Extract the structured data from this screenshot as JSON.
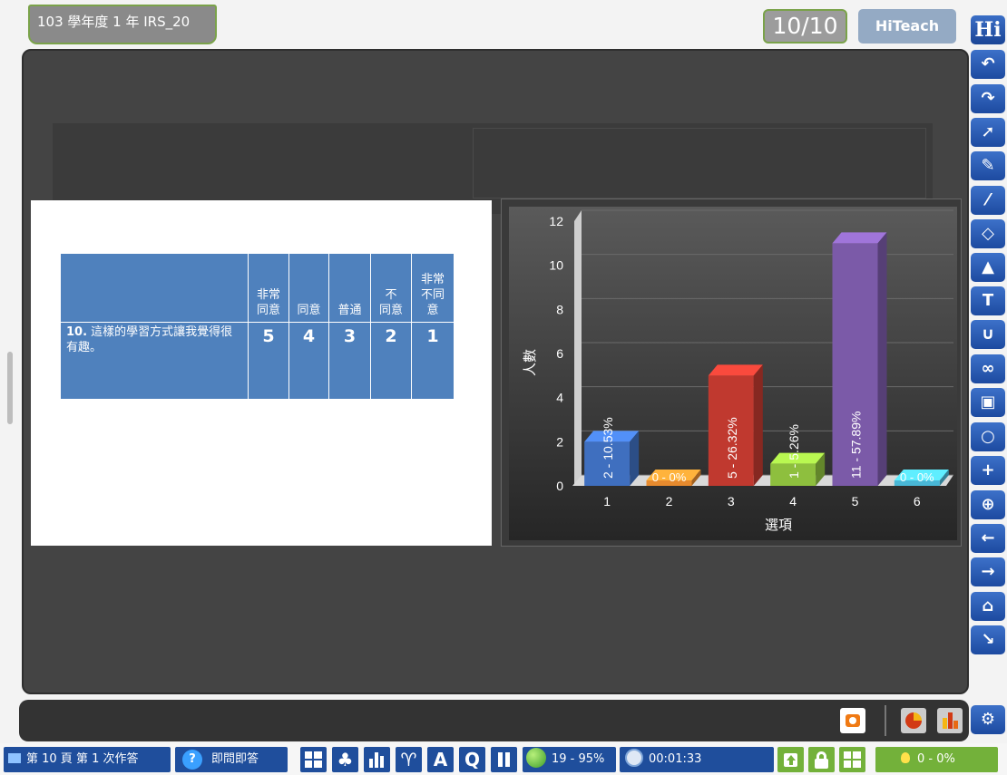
{
  "header": {
    "title": "103 學年度 1 年 IRS_20",
    "page_counter": "10/10",
    "hiteach_label": "HiTeach"
  },
  "survey": {
    "headers": [
      "非常\n同意",
      "同意",
      "普通",
      "不\n同意",
      "非常\n不同\n意"
    ],
    "question_number": "10.",
    "question_text": "這樣的學習方式讓我覺得很有趣。",
    "values": [
      "5",
      "4",
      "3",
      "2",
      "1"
    ]
  },
  "chart_data": {
    "type": "bar",
    "categories": [
      "1",
      "2",
      "3",
      "4",
      "5",
      "6"
    ],
    "values": [
      2,
      0,
      5,
      1,
      11,
      0
    ],
    "data_labels": [
      "2 - 10.53%",
      "0 - 0%",
      "5 - 26.32%",
      "1 - 5.26%",
      "11 - 57.89%",
      "0 - 0%"
    ],
    "colors": [
      "#3f6fbf",
      "#e68a2e",
      "#c0392f",
      "#8ebf3e",
      "#7b5aa8",
      "#49b7d6"
    ],
    "xlabel": "選項",
    "ylabel": "人數",
    "ylim": [
      0,
      12
    ],
    "yticks": [
      "0",
      "2",
      "4",
      "6",
      "8",
      "10",
      "12"
    ],
    "grid": true
  },
  "taskbar": {
    "page_status": "第 10 頁 第 1 次作答",
    "help_icon": "?",
    "instant_label": "即問即答",
    "letter_a": "A",
    "letter_q": "Q",
    "response_stat": "19 - 95%",
    "timer": "00:01:33",
    "answer_stat": "0 - 0%"
  },
  "toolbar_icons": [
    "hi-logo-icon",
    "undo-icon",
    "redo-icon",
    "pointer-icon",
    "pen-icon",
    "brush-icon",
    "eraser-icon",
    "shapes-icon",
    "text-icon",
    "magnet-icon",
    "link-icon",
    "camera-robot-icon",
    "zoom-icon",
    "add-page-icon",
    "insert-page-icon",
    "prev-page-icon",
    "next-page-icon",
    "trash-icon",
    "collapse-icon",
    "settings-icon"
  ]
}
